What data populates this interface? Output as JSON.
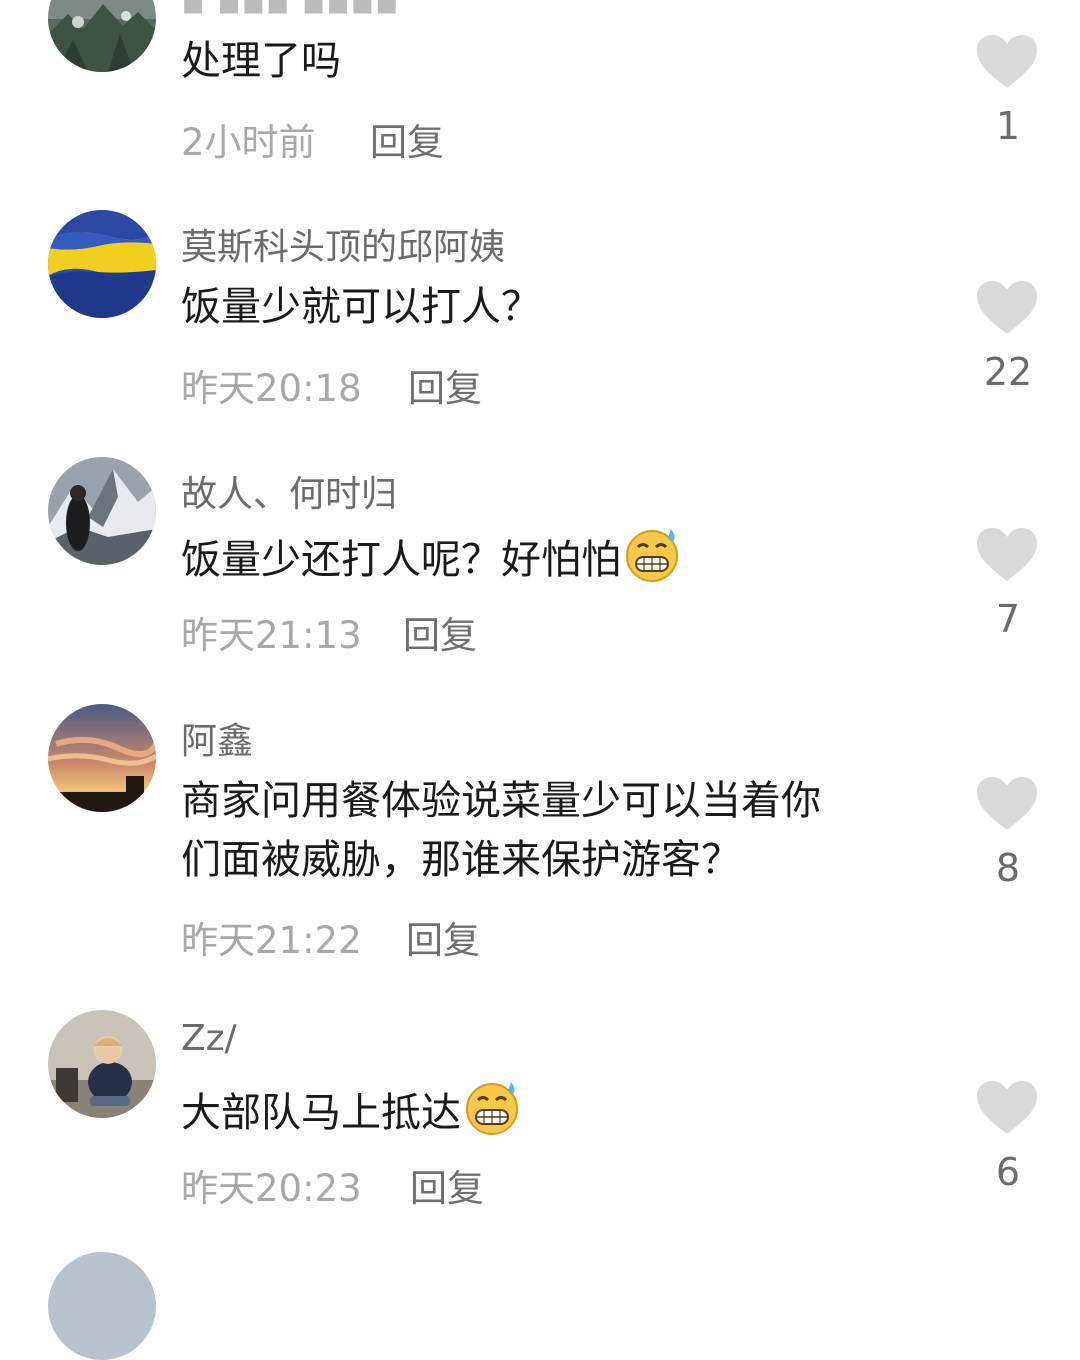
{
  "reply_label": "回复",
  "like_icon_color": "#d9d9d9",
  "comments": [
    {
      "content": [
        "处理了吗"
      ],
      "time": "2小时前",
      "likes": "1"
    },
    {
      "username": "莫斯科头顶的邱阿姨",
      "content": [
        "饭量少就可以打人？"
      ],
      "time": "昨天20:18",
      "likes": "22"
    },
    {
      "username": "故人、何时归",
      "content": [
        "饭量少还打人呢？好怕怕"
      ],
      "emoji": "grin-sweat-emoji",
      "time": "昨天21:13",
      "likes": "7"
    },
    {
      "username": "阿鑫",
      "content": [
        "商家问用餐体验说菜量少可以当着你",
        "们面被威胁，那谁来保护游客？"
      ],
      "time": "昨天21:22",
      "likes": "8"
    },
    {
      "username": "Zz/",
      "content": [
        "大部队马上抵达"
      ],
      "emoji": "grin-sweat-emoji",
      "time": "昨天20:23",
      "likes": "6"
    }
  ]
}
